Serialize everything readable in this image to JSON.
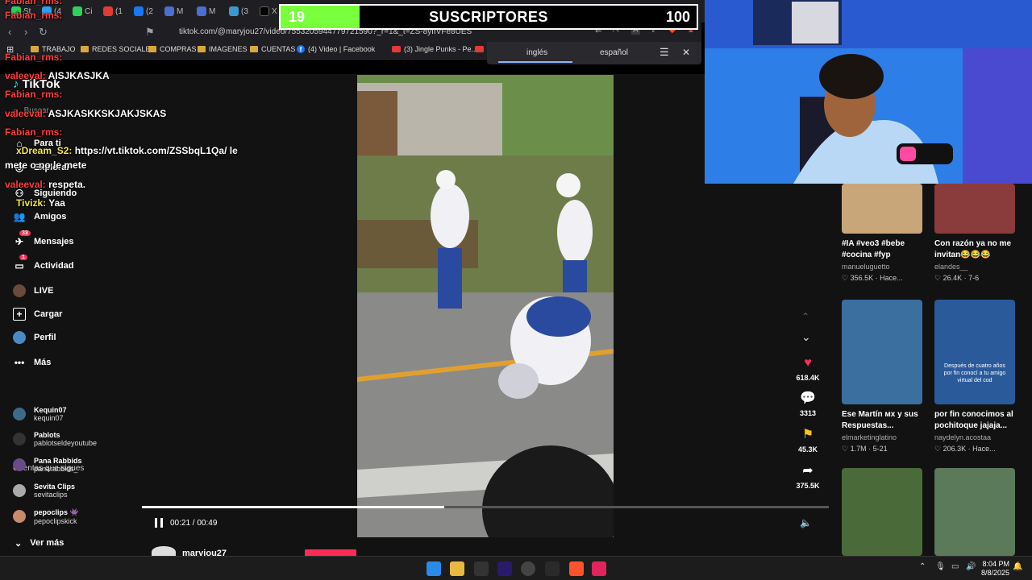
{
  "browser": {
    "tabs": [
      "St",
      "(4",
      "Ci",
      "(1",
      "(2",
      "M",
      "M",
      "(3",
      "X",
      "M"
    ],
    "url": "tiktok.com/@maryjou27/video/7553205944779721590?_r=1&_t=ZS-8yIIVFe8UES",
    "bookmarks": [
      "TRABAJO",
      "REDES SOCIALES",
      "COMPRAS",
      "IMAGENES",
      "CUENTAS",
      "(4) Video | Facebook",
      "(3) Jingle Punks - Pe...",
      "P"
    ]
  },
  "translate": {
    "tab1": "inglés",
    "tab2": "español"
  },
  "counter": {
    "current": "19",
    "label": "SUSCRIPTORES",
    "goal": "100",
    "progress_fraction": 0.19
  },
  "tiktok": {
    "logo": "TikTok",
    "search_placeholder": "Buscar",
    "nav": [
      {
        "label": "Para ti",
        "icon": "home-icon"
      },
      {
        "label": "Explorar",
        "icon": "compass-icon"
      },
      {
        "label": "Siguiendo",
        "icon": "following-icon"
      },
      {
        "label": "Amigos",
        "icon": "friends-icon"
      },
      {
        "label": "Mensajes",
        "icon": "messages-icon",
        "badge": "33"
      },
      {
        "label": "Actividad",
        "icon": "activity-icon",
        "badge": "1"
      },
      {
        "label": "LIVE",
        "icon": "live-icon"
      },
      {
        "label": "Cargar",
        "icon": "upload-icon"
      },
      {
        "label": "Perfil",
        "icon": "profile-icon"
      },
      {
        "label": "Más",
        "icon": "more-icon"
      }
    ],
    "following_title": "Cuentas que sigues",
    "following": [
      {
        "name": "Kequin07",
        "handle": "kequin07",
        "color": "#3c6a8a"
      },
      {
        "name": "Pablots",
        "handle": "pablotseldeyoutube",
        "color": "#333"
      },
      {
        "name": "Pana Rabbids",
        "handle": "panarabbids_",
        "color": "#6a4a8a"
      },
      {
        "name": "Sevita Clips",
        "handle": "sevitaclips",
        "color": "#aaa"
      },
      {
        "name": "pepoclips 👾",
        "handle": "pepoclipskick",
        "color": "#c98a6a"
      }
    ],
    "see_more": "Ver más"
  },
  "video": {
    "time": "00:21 / 00:49",
    "progress_fraction": 0.44,
    "author": "maryjou27",
    "likes": "618.4K",
    "comments": "3313",
    "saves": "45.3K",
    "shares": "375.5K"
  },
  "related": [
    {
      "title": "#IA #veo3 #bebe #cocina #fyp",
      "author": "manueluguetto",
      "stats": "356.5K · Hace...",
      "color": "#c9a57a"
    },
    {
      "title": "Con razón ya no me invitan😂😂😂",
      "author": "elandes__",
      "stats": "26.4K · 7-6",
      "color": "#8a3b3b"
    },
    {
      "title": "Ese Martín ᴍx y sus Respuestas...",
      "author": "elmarketinglatino",
      "stats": "1.7M · 5-21",
      "color": "#3a6fa0"
    },
    {
      "title": "por fin conocimos al pochitoque jajaja...",
      "author": "naydelyn.acostaa",
      "stats": "206.3K · Hace...",
      "color": "#2a5a9a",
      "overlay": "Después de cuatro años por fin conocí a tu amigo virtual del cod"
    },
    {
      "title": "",
      "author": "",
      "stats": "",
      "color": "#4a6a3a"
    },
    {
      "title": "",
      "author": "",
      "stats": "",
      "color": "#5a7a5a"
    }
  ],
  "chat": [
    {
      "user": "Fabian_rms:",
      "text": "",
      "style": "u"
    },
    {
      "user": "Fabian_rms:",
      "text": "",
      "style": "u"
    },
    {
      "user": "Fabian_rms:",
      "text": "",
      "style": "u"
    },
    {
      "user": "valeeval:",
      "text": "AISJKASJKA",
      "style": "u"
    },
    {
      "user": "Fabian_rms:",
      "text": "",
      "style": "u"
    },
    {
      "user": "valeeval:",
      "text": "ASJKASKKSKJAKJSKAS",
      "style": "u"
    },
    {
      "user": "Fabian_rms:",
      "text": "",
      "style": "u"
    },
    {
      "user": "xDream_S2:",
      "text": "https://vt.tiktok.com/ZSSbqL1Qa/ le",
      "style": "u2"
    },
    {
      "user": "",
      "text": "mete o no le mete",
      "style": ""
    },
    {
      "user": "valeeval:",
      "text": "respeta.",
      "style": "u"
    },
    {
      "user": "Tivizk:",
      "text": "Yaa",
      "style": "u2"
    }
  ],
  "taskbar": {
    "time": "8:04 PM",
    "date": "8/8/2025"
  }
}
